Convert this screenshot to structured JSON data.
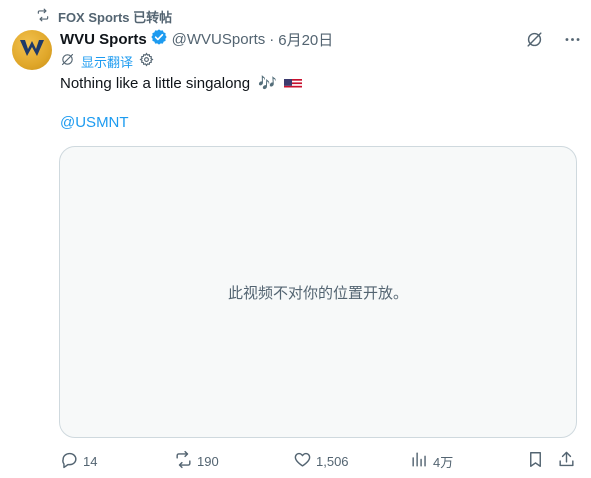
{
  "repost": {
    "icon": "repost-icon",
    "text": "FOX Sports 已转帖"
  },
  "author": {
    "avatar_icon": "wvu-logo",
    "name": "WVU Sports",
    "verified_icon": "verified-badge-icon",
    "handle": "@WVUSports",
    "separator": "·",
    "time": "6月20日"
  },
  "header_actions": {
    "grok_icon": "grok-icon",
    "more_icon": "more-icon"
  },
  "translate": {
    "grok_icon": "grok-icon",
    "label": "显示翻译",
    "settings_icon": "gear-icon"
  },
  "tweet": {
    "text": "Nothing like a little singalong",
    "emoji_notes": "🎶",
    "emoji_flag": "us-flag",
    "mention": "@USMNT"
  },
  "media": {
    "message": "此视频不对你的位置开放。"
  },
  "actions": {
    "reply": {
      "icon": "reply-icon",
      "count": "14"
    },
    "repost": {
      "icon": "repost-icon",
      "count": "190"
    },
    "like": {
      "icon": "heart-icon",
      "count": "1,506"
    },
    "views": {
      "icon": "views-icon",
      "count": "4万"
    },
    "bookmark": {
      "icon": "bookmark-icon"
    },
    "share": {
      "icon": "share-icon"
    }
  },
  "colors": {
    "accent": "#1d9bf0",
    "secondary_text": "#536471",
    "primary_text": "#0f1419",
    "border": "#cfd9de",
    "avatar_gold": "#eab308"
  }
}
